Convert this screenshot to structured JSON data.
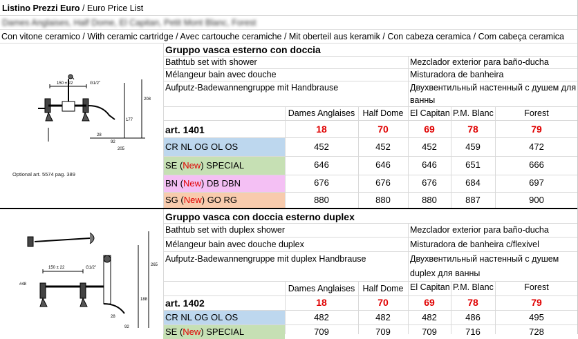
{
  "header": {
    "title_bold": "Listino Prezzi Euro",
    "title_rest": " / Euro Price List",
    "blurred_line": "Dames Anglaises, Half Dome, El Capitan, Petit Mont Blanc, Forest",
    "cartridge_line": "Con vitone ceramico / With ceramic cartridge / Avec cartouche ceramiche / Mit oberteil aus keramik / Con cabeza ceramica / Com cabeça ceramica"
  },
  "colors": {
    "blue": "#bdd7ee",
    "green": "#c6e0b4",
    "pink": "#f4c0f4",
    "orange": "#f8cbad",
    "red": "#e00000"
  },
  "section1": {
    "title": "Gruppo vasca esterno con doccia",
    "desc_left": [
      "Bathtub set with shower",
      "Mélangeur bain avec douche",
      "Aufputz-Badewannengruppe mit Handbrause"
    ],
    "desc_right": [
      "Mezclador exterior para baño-ducha",
      "Misturadora de banheira",
      "Двухвентильный настенный с душем для",
      "ванны"
    ],
    "optional_note": "Optional art. 5574 pag. 389",
    "columns": [
      "Dames Anglaises",
      "Half Dome",
      "El Capitan",
      "P.M. Blanc",
      "Forest"
    ],
    "article": "art. 1401",
    "article_codes": [
      "18",
      "70",
      "69",
      "78",
      "79"
    ],
    "rows": [
      {
        "pre": "CR NL OG OL OS",
        "new": "",
        "post": "",
        "values": [
          "452",
          "452",
          "452",
          "459",
          "472"
        ]
      },
      {
        "pre": "SE (",
        "new": "New",
        "post": ") SPECIAL",
        "values": [
          "646",
          "646",
          "646",
          "651",
          "666"
        ]
      },
      {
        "pre": "BN (",
        "new": "New",
        "post": ") DB DBN",
        "values": [
          "676",
          "676",
          "676",
          "684",
          "697"
        ]
      },
      {
        "pre": "SG (",
        "new": "New",
        "post": ") GO RG",
        "values": [
          "880",
          "880",
          "880",
          "887",
          "900"
        ]
      }
    ]
  },
  "section2": {
    "title": "Gruppo vasca con doccia esterno duplex",
    "desc_left": [
      "Bathtub set with duplex shower",
      "Mélangeur bain avec douche duplex",
      "Aufputz-Badewannengruppe mit duplex Handbrause"
    ],
    "desc_right": [
      "Mezclador exterior para baño-ducha",
      "Misturadora de banheira c/flexivel",
      "Двухвентильный настенный с душем",
      "duplex для ванны"
    ],
    "columns": [
      "Dames Anglaises",
      "Half Dome",
      "El Capitan",
      "P.M. Blanc",
      "Forest"
    ],
    "article": "art. 1402",
    "article_codes": [
      "18",
      "70",
      "69",
      "78",
      "79"
    ],
    "rows": [
      {
        "pre": "CR NL OG OL OS",
        "new": "",
        "post": "",
        "values": [
          "482",
          "482",
          "482",
          "486",
          "495"
        ]
      },
      {
        "pre": "SE (",
        "new": "New",
        "post": ") SPECIAL",
        "values": [
          "709",
          "709",
          "709",
          "716",
          "728"
        ]
      }
    ]
  },
  "drawing_dims": {
    "d1": [
      "150 ± 22",
      "G1/2\"",
      "208",
      "177",
      "28",
      "92",
      "205"
    ],
    "d2": [
      "150 ± 22",
      "G1/2\"",
      "265",
      "188",
      "28",
      "92",
      "#48"
    ]
  }
}
